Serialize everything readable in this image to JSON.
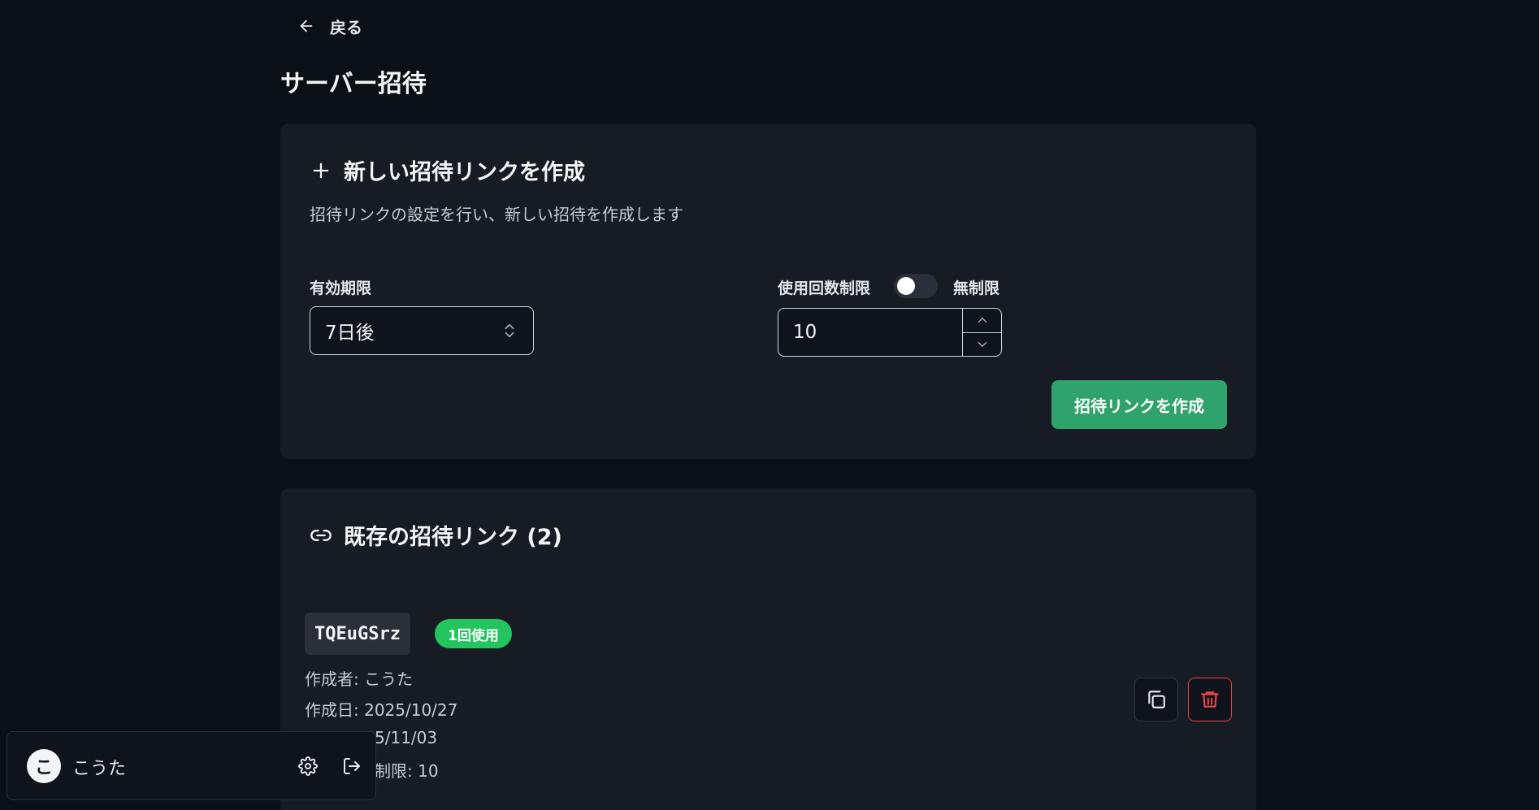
{
  "nav": {
    "back_label": "戻る"
  },
  "page": {
    "title": "サーバー招待"
  },
  "create_card": {
    "title": "新しい招待リンクを作成",
    "description": "招待リンクの設定を行い、新しい招待を作成します",
    "expiry_label": "有効期限",
    "expiry_value": "7日後",
    "usage_limit_label": "使用回数制限",
    "unlimited_label": "無制限",
    "unlimited_enabled": false,
    "usage_limit_value": "10",
    "create_button": "招待リンクを作成"
  },
  "list_card": {
    "title": "既存の招待リンク (2)",
    "invites": [
      {
        "code": "TQEuGSrz",
        "badge": "1回使用",
        "created_by": "作成者: こうた",
        "created_at": "作成日: 2025/10/27",
        "expires_partial": "5/11/03",
        "limit_partial": "制限: 10"
      }
    ]
  },
  "user": {
    "avatar_initial": "こ",
    "name": "こうた"
  },
  "colors": {
    "background": "#0b0f16",
    "card": "#161b24",
    "accent": "#2fa36b",
    "badge": "#22c55e",
    "danger": "#ef4444"
  }
}
